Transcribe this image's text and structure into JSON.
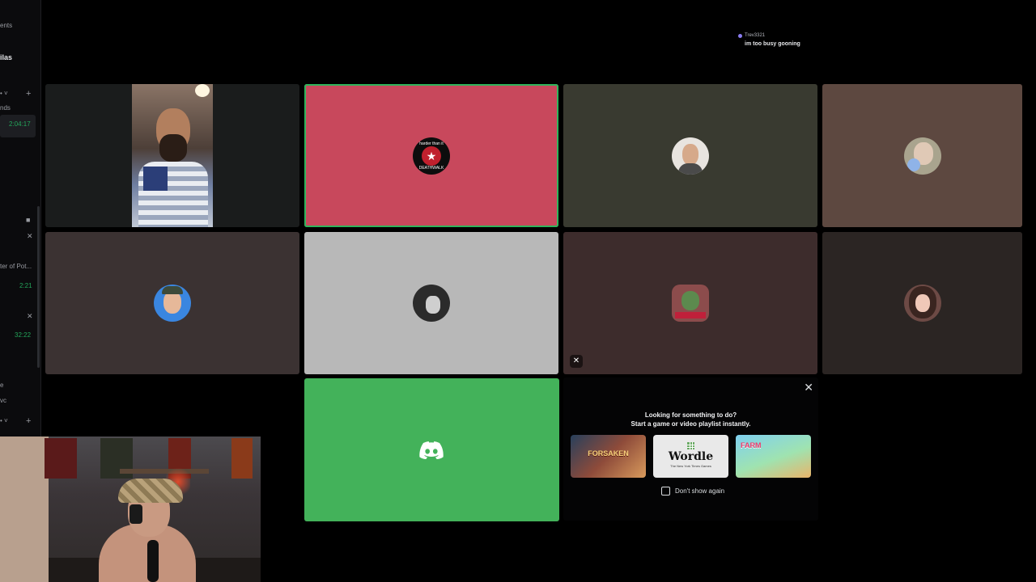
{
  "sidebar": {
    "items": [
      {
        "text": "ents"
      },
      {
        "text": "ilas"
      },
      {
        "text": "• ˅"
      },
      {
        "text": "+"
      },
      {
        "text": "nds"
      },
      {
        "text": "2:04:17"
      },
      {
        "text": "ter of Pot..."
      },
      {
        "text": "2:21"
      },
      {
        "text": "32:22"
      },
      {
        "text": "e"
      },
      {
        "text": "vc"
      },
      {
        "text": "• ˅"
      },
      {
        "text": "+"
      }
    ]
  },
  "overlay_message": {
    "author": "Trev3321",
    "text": "im too busy gooning"
  },
  "tiles": [
    {
      "type": "camera",
      "bg": "#1a1c1c"
    },
    {
      "type": "avatar",
      "bg": "#c8485c",
      "speaking": true,
      "avatar_text": "harder than it",
      "avatar_subtext": "DEATHWALK",
      "avatar_bg": "#0d0d0d"
    },
    {
      "type": "avatar",
      "bg": "#393a30",
      "avatar_bg": "#cdb7a3"
    },
    {
      "type": "avatar",
      "bg": "#5d4840",
      "avatar_bg": "#a9a48e"
    },
    {
      "type": "avatar",
      "bg": "#3b3232",
      "avatar_bg": "#3a86e0"
    },
    {
      "type": "avatar",
      "bg": "#b8b8b8",
      "avatar_bg": "#2b2b2b"
    },
    {
      "type": "avatar",
      "bg": "#3d2c2c",
      "avatar_bg": "#8c4c4c",
      "muted_icon": "mic-muted-icon"
    },
    {
      "type": "avatar",
      "bg": "#2b2523",
      "avatar_bg": "#6d4a45"
    },
    {
      "type": "logo",
      "bg": "#43b25a",
      "icon": "discord-logo-icon"
    }
  ],
  "activity_panel": {
    "title": "Looking for something to do?",
    "subtitle": "Start a game or video playlist instantly.",
    "close_icon": "close-icon",
    "games": [
      {
        "name": "FORSAKEN",
        "label": "FORSAKEN"
      },
      {
        "name": "Wordle",
        "label": "Wordle",
        "sub": "The New York Times Games"
      },
      {
        "name": "Farm Merge Valley",
        "label": "FARM"
      }
    ],
    "dont_show_label": "Don't show again",
    "dont_show_checked": false
  },
  "colors": {
    "speaking_ring": "#2fb45c",
    "discord_green": "#43b25a",
    "background": "#000000"
  }
}
